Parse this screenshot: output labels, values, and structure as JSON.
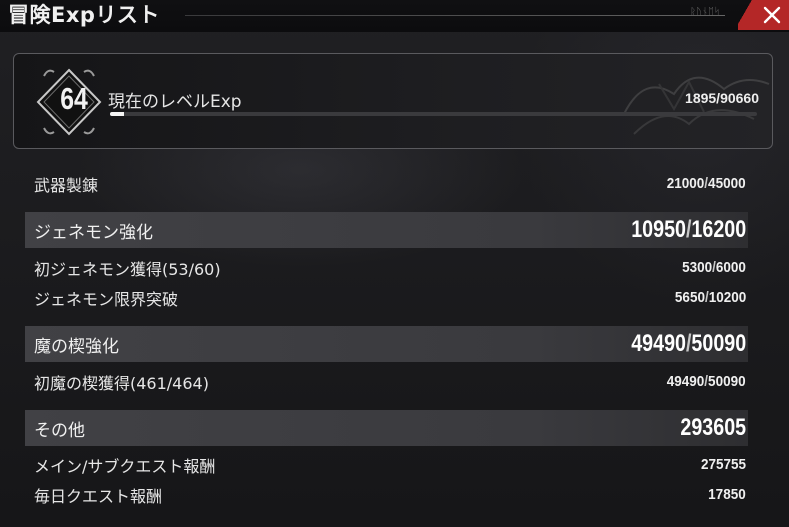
{
  "window": {
    "title": "冒険Expリスト",
    "title_deco": "ᚱᚢᚾᛖᛋ"
  },
  "level": {
    "number": "64",
    "label": "現在のレベルExp",
    "current": 1895,
    "max": 90660,
    "value_text": "1895/90660",
    "progress": 0.021
  },
  "rows": [
    {
      "type": "item",
      "label": "武器製錬",
      "value": "21000",
      "max": "45000"
    },
    {
      "type": "header",
      "label": "ジェネモン強化",
      "value": "10950",
      "max": "16200"
    },
    {
      "type": "item",
      "label": "初ジェネモン獲得(53/60)",
      "value": "5300",
      "max": "6000"
    },
    {
      "type": "item",
      "label": "ジェネモン限界突破",
      "value": "5650",
      "max": "10200"
    },
    {
      "type": "header",
      "label": "魔の楔強化",
      "value": "49490",
      "max": "50090"
    },
    {
      "type": "item",
      "label": "初魔の楔獲得(461/464)",
      "value": "49490",
      "max": "50090"
    },
    {
      "type": "header",
      "label": "その他",
      "value": "293605",
      "max": ""
    },
    {
      "type": "item",
      "label": "メイン/サブクエスト報酬",
      "value": "275755",
      "max": ""
    },
    {
      "type": "item",
      "label": "毎日クエスト報酬",
      "value": "17850",
      "max": ""
    }
  ],
  "colors": {
    "close_button": "#b42727",
    "header_row": "#414145",
    "progress_fill": "#f4f4f4"
  },
  "icons": {
    "close": "close-icon",
    "emblem": "level-emblem-icon"
  }
}
